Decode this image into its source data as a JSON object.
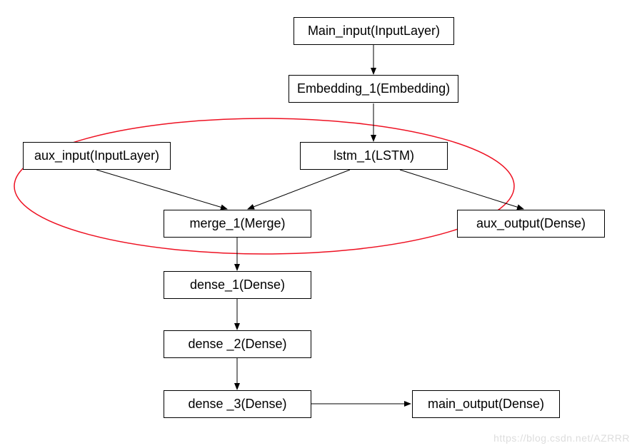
{
  "nodes": {
    "main_input": "Main_input(InputLayer)",
    "embedding_1": "Embedding_1(Embedding)",
    "aux_input": "aux_input(InputLayer)",
    "lstm_1": "lstm_1(LSTM)",
    "merge_1": "merge_1(Merge)",
    "aux_output": "aux_output(Dense)",
    "dense_1": "dense_1(Dense)",
    "dense_2": "dense _2(Dense)",
    "dense_3": "dense _3(Dense)",
    "main_output": "main_output(Dense)"
  },
  "watermark": "https://blog.csdn.net/AZRRR",
  "highlight": {
    "description": "red-ellipse",
    "encircled_nodes": [
      "aux_input",
      "lstm_1",
      "merge_1"
    ]
  },
  "edges": [
    {
      "from": "main_input",
      "to": "embedding_1"
    },
    {
      "from": "embedding_1",
      "to": "lstm_1"
    },
    {
      "from": "aux_input",
      "to": "merge_1"
    },
    {
      "from": "lstm_1",
      "to": "merge_1"
    },
    {
      "from": "lstm_1",
      "to": "aux_output"
    },
    {
      "from": "merge_1",
      "to": "dense_1"
    },
    {
      "from": "dense_1",
      "to": "dense_2"
    },
    {
      "from": "dense_2",
      "to": "dense_3"
    },
    {
      "from": "dense_3",
      "to": "main_output"
    }
  ]
}
